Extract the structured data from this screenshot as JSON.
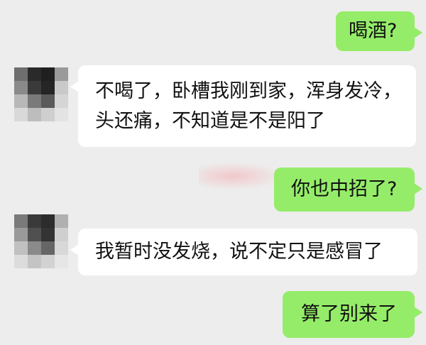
{
  "chat": {
    "messages": [
      {
        "side": "out",
        "text": "喝酒?"
      },
      {
        "side": "in",
        "lines": [
          "不喝了，卧槽我刚到家，浑身发冷，",
          "头还痛，不知道是不是阳了"
        ]
      },
      {
        "side": "out",
        "text": "你也中招了?"
      },
      {
        "side": "in",
        "text": "我暂时没发烧，说不定只是感冒了"
      },
      {
        "side": "out",
        "text": "算了别来了"
      }
    ]
  },
  "colors": {
    "background": "#ededed",
    "outgoing_bubble": "#95ec69",
    "incoming_bubble": "#ffffff"
  },
  "icons": {
    "avatar": "pixelated-avatar-icon"
  }
}
